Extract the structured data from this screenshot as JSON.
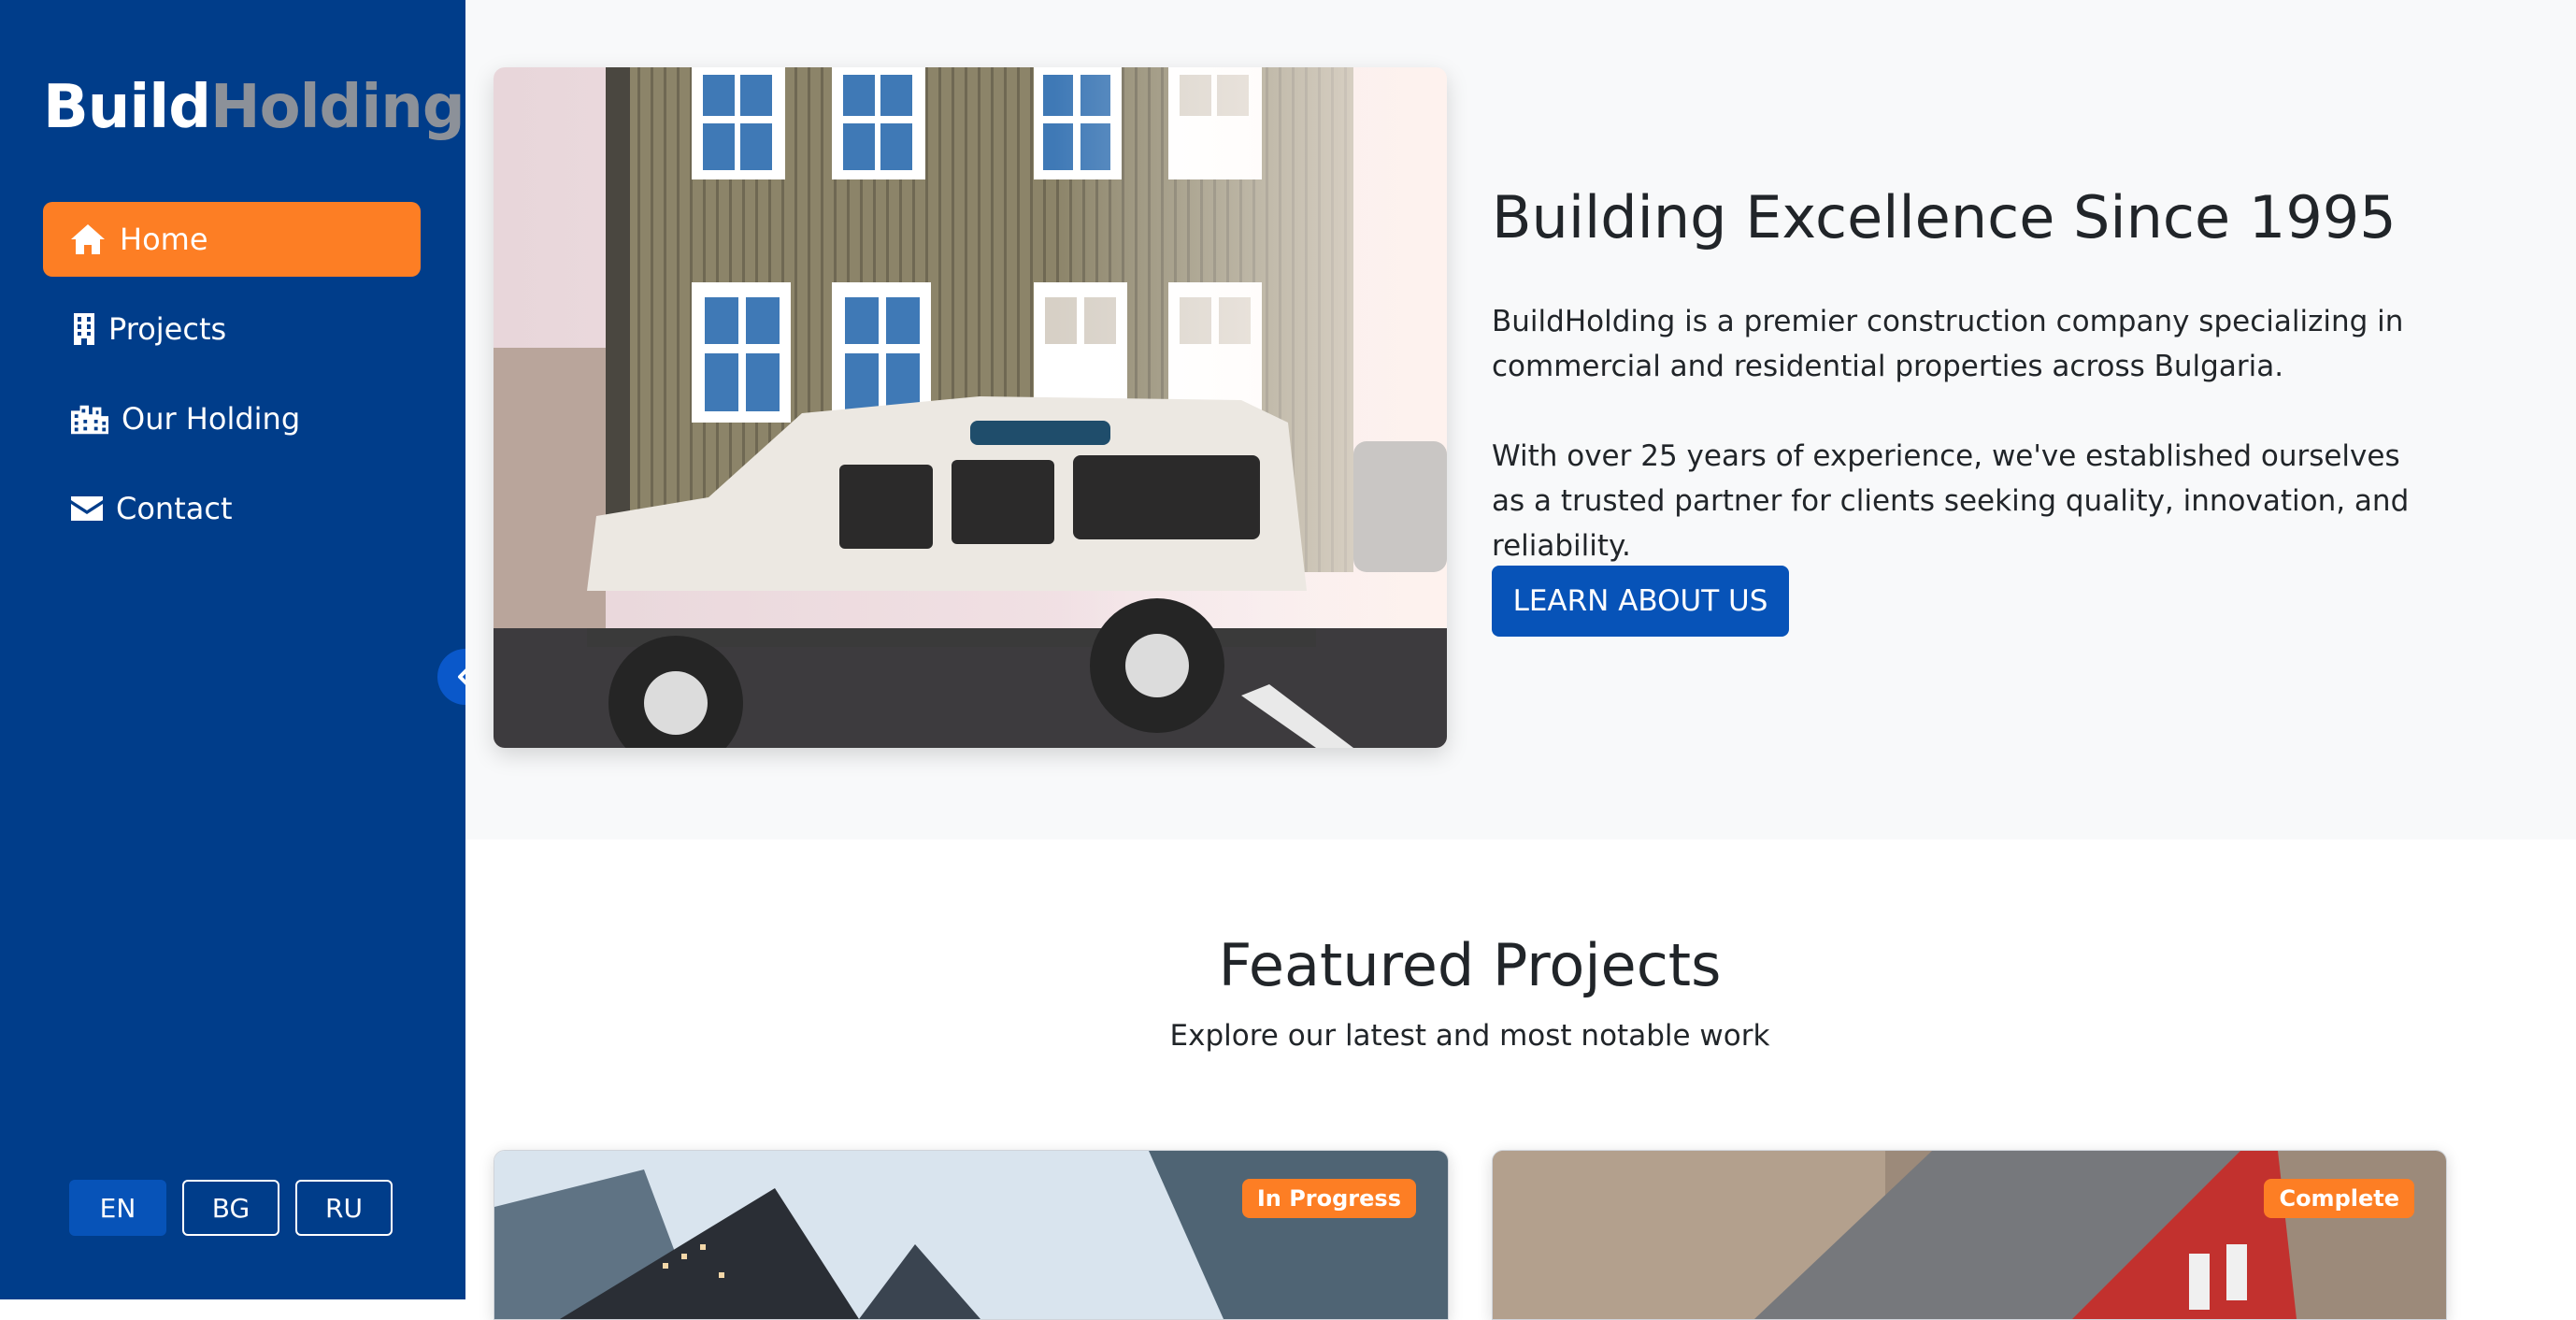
{
  "brand": {
    "part1": "Build",
    "part2": "Holding"
  },
  "nav": {
    "items": [
      {
        "label": "Home",
        "icon": "home-icon",
        "active": true
      },
      {
        "label": "Projects",
        "icon": "building-icon",
        "active": false
      },
      {
        "label": "Our Holding",
        "icon": "city-icon",
        "active": false
      },
      {
        "label": "Contact",
        "icon": "envelope-icon",
        "active": false
      }
    ]
  },
  "languages": [
    {
      "label": "EN",
      "active": true
    },
    {
      "label": "BG",
      "active": false
    },
    {
      "label": "RU",
      "active": false
    }
  ],
  "hero": {
    "title": "Building Excellence Since 1995",
    "paragraph1": "BuildHolding is a premier construction company specializing in commercial and residential properties across Bulgaria.",
    "paragraph2": "With over 25 years of experience, we've established ourselves as a trusted partner for clients seeking quality, innovation, and reliability.",
    "button": "LEARN ABOUT US"
  },
  "featured": {
    "title": "Featured Projects",
    "subtitle": "Explore our latest and most notable work",
    "cards": [
      {
        "badge": "In Progress"
      },
      {
        "badge": "Complete"
      }
    ]
  },
  "colors": {
    "sidebar": "#003d8a",
    "accent": "#fd7e24",
    "primary": "#0753b8"
  }
}
